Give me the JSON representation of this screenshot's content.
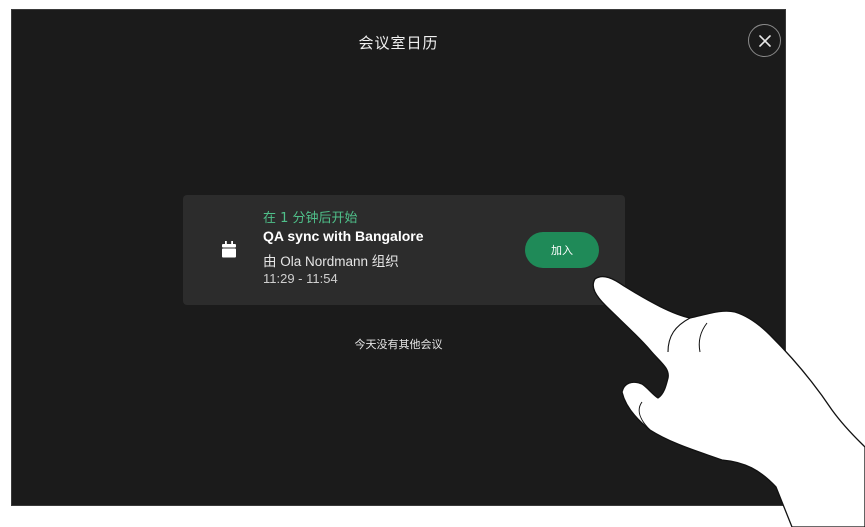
{
  "header": {
    "title": "会议室日历"
  },
  "icons": {
    "close": "close-icon",
    "calendar": "calendar-icon"
  },
  "meeting": {
    "starts_in": "在 1 分钟后开始",
    "title": "QA sync with Bangalore",
    "organizer": "由 Ola Nordmann 组织",
    "time": "11:29 - 11:54",
    "join_label": "加入"
  },
  "footer": {
    "no_more_meetings": "今天没有其他会议"
  },
  "colors": {
    "background": "#1b1b1b",
    "card": "#2c2c2c",
    "accent_green": "#1f8a58",
    "status_green": "#4fc08a"
  }
}
